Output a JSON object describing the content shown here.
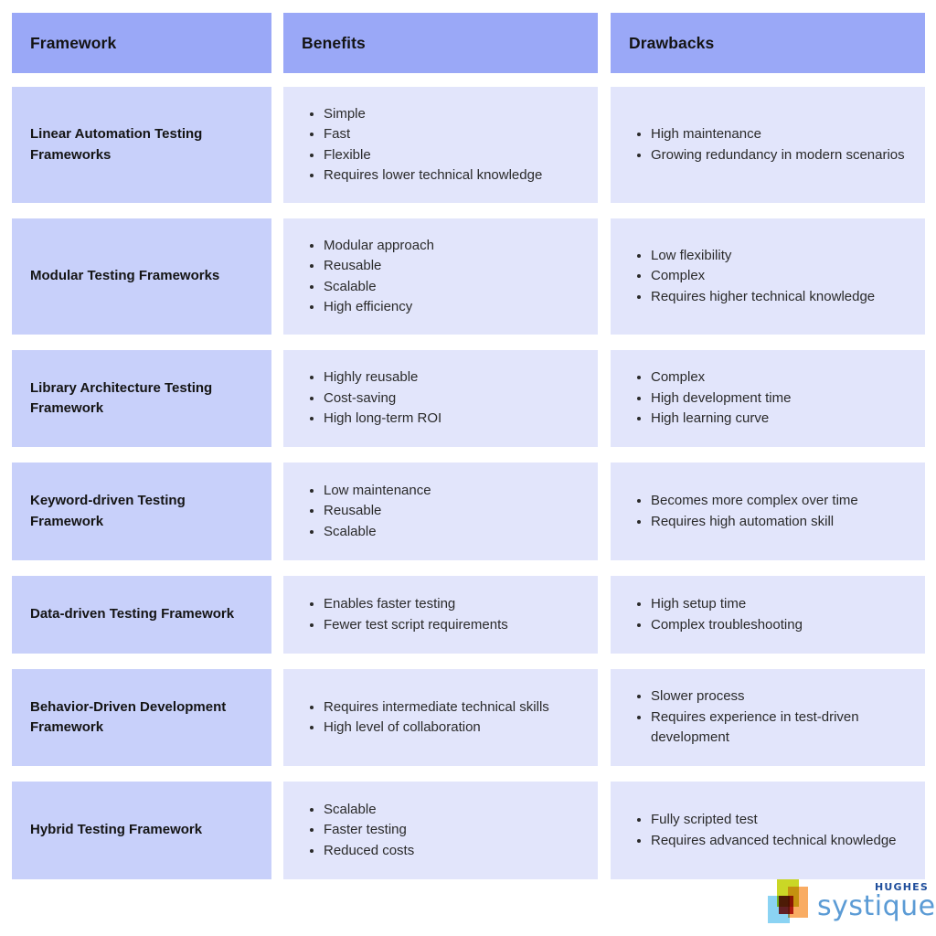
{
  "table": {
    "columns": [
      {
        "key": "framework",
        "label": "Framework"
      },
      {
        "key": "benefits",
        "label": "Benefits"
      },
      {
        "key": "drawbacks",
        "label": "Drawbacks"
      }
    ],
    "header_bg": "#9aa8f7",
    "name_cell_bg": "#c8d0fa",
    "list_cell_bg": "#e2e5fb",
    "rows": [
      {
        "framework": "Linear Automation Testing Frameworks",
        "benefits": [
          "Simple",
          "Fast",
          "Flexible",
          "Requires lower technical knowledge"
        ],
        "drawbacks": [
          "High maintenance",
          "Growing redundancy in modern scenarios"
        ]
      },
      {
        "framework": "Modular Testing Frameworks",
        "benefits": [
          "Modular approach",
          "Reusable",
          "Scalable",
          "High efficiency"
        ],
        "drawbacks": [
          "Low flexibility",
          "Complex",
          "Requires higher technical knowledge"
        ]
      },
      {
        "framework": "Library Architecture Testing Framework",
        "benefits": [
          "Highly reusable",
          "Cost-saving",
          "High long-term ROI"
        ],
        "drawbacks": [
          "Complex",
          "High development time",
          "High learning curve"
        ]
      },
      {
        "framework": "Keyword-driven Testing Framework",
        "benefits": [
          "Low maintenance",
          "Reusable",
          "Scalable"
        ],
        "drawbacks": [
          "Becomes more complex over time",
          "Requires high automation skill"
        ]
      },
      {
        "framework": "Data-driven Testing Framework",
        "benefits": [
          "Enables faster testing",
          "Fewer test script requirements"
        ],
        "drawbacks": [
          "High setup time",
          "Complex troubleshooting"
        ]
      },
      {
        "framework": "Behavior-Driven Development Framework",
        "benefits": [
          "Requires intermediate technical skills",
          "High level of collaboration"
        ],
        "drawbacks": [
          "Slower process",
          "Requires experience in test-driven development"
        ]
      },
      {
        "framework": "Hybrid Testing Framework",
        "benefits": [
          "Scalable",
          "Faster testing",
          "Reduced costs"
        ],
        "drawbacks": [
          "Fully scripted test",
          "Requires advanced technical knowledge"
        ]
      }
    ]
  },
  "logo": {
    "top_word": "HUGHES",
    "main_word": "systique",
    "top_word_color": "#1f4e9c",
    "main_word_color": "#5b9bd5",
    "mark_colors": [
      "#c6d414",
      "#f8973c",
      "#6ec8f0",
      "#ac1414"
    ]
  }
}
